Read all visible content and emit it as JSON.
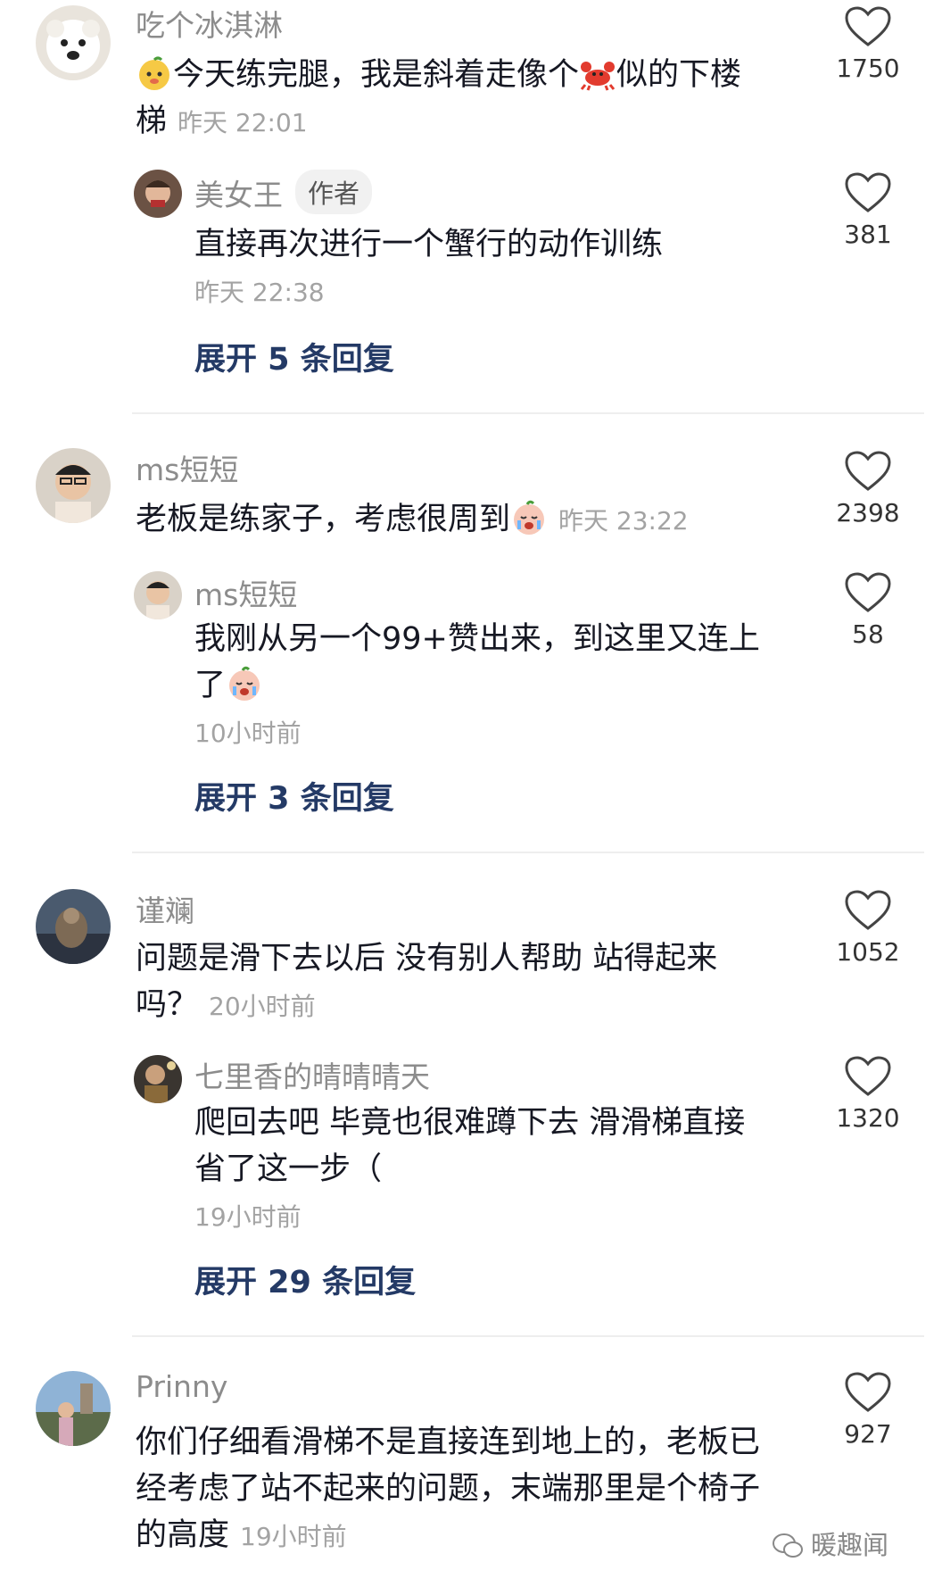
{
  "comments": [
    {
      "user": "吃个冰淇淋",
      "text_a": "今天练完腿，我是斜着走像个",
      "text_b": "似的下楼",
      "text_c": "梯",
      "time": "昨天 22:01",
      "likes": "1750",
      "emoji_a": "mango-face-emoji",
      "emoji_b": "crab-emoji",
      "reply": {
        "user": "美女王",
        "badge": "作者",
        "text": "直接再次进行一个蟹行的动作训练",
        "time": "昨天 22:38",
        "likes": "381"
      },
      "expand": "展开 5 条回复"
    },
    {
      "user": "ms短短",
      "text": "老板是练家子，考虑很周到",
      "time": "昨天 23:22",
      "likes": "2398",
      "emoji": "crying-face-emoji",
      "reply": {
        "user": "ms短短",
        "text_a": "我刚从另一个99+赞出来，到这里又连上",
        "text_b": "了",
        "time": "10小时前",
        "likes": "58",
        "emoji": "crying-face-emoji"
      },
      "expand": "展开 3 条回复"
    },
    {
      "user": "谨斓",
      "text_a": "问题是滑下去以后 没有别人帮助 站得起来",
      "text_b": "吗？",
      "time": "20小时前",
      "likes": "1052",
      "reply": {
        "user": "七里香的晴晴晴天",
        "text_a": "爬回去吧 毕竟也很难蹲下去 滑滑梯直接",
        "text_b": "省了这一步（",
        "time": "19小时前",
        "likes": "1320"
      },
      "expand": "展开 29 条回复"
    },
    {
      "user": "Prinny",
      "text_a": "你们仔细看滑梯不是直接连到地上的，老板已",
      "text_b": "经考虑了站不起来的问题，末端那里是个椅子",
      "text_c": "的高度",
      "time": "19小时前",
      "likes": "927"
    }
  ],
  "watermark": "暖趣闻",
  "colors": {
    "expand": "#243a66",
    "divider": "#eeeeee",
    "muted": "#8c8c8c"
  }
}
